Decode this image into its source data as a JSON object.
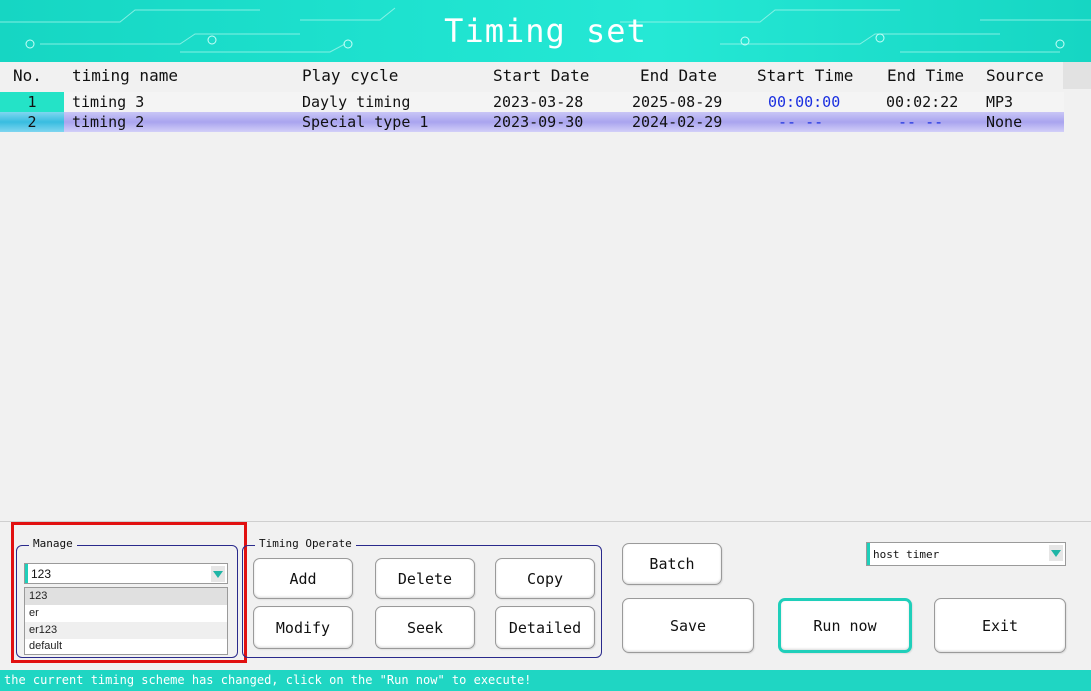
{
  "window": {
    "title": "Timing set"
  },
  "table": {
    "headers": [
      "No.",
      "timing name",
      "Play cycle",
      "Start Date",
      "End Date",
      "Start Time",
      "End Time",
      "Source"
    ],
    "rows": [
      {
        "no": "1",
        "name": "timing 3",
        "cycle": "Dayly timing",
        "start_date": "2023-03-28",
        "end_date": "2025-08-29",
        "start_time": "00:00:00",
        "end_time": "00:02:22",
        "source": "MP3"
      },
      {
        "no": "2",
        "name": "timing 2",
        "cycle": "Special type 1",
        "start_date": "2023-09-30",
        "end_date": "2024-02-29",
        "start_time": "-- --",
        "end_time": "-- --",
        "source": "None"
      }
    ]
  },
  "manage": {
    "legend": "Manage",
    "selected": "123",
    "options": [
      "123",
      "er",
      "er123",
      "default"
    ]
  },
  "timing_operate": {
    "legend": "Timing Operate",
    "add": "Add",
    "delete": "Delete",
    "copy": "Copy",
    "modify": "Modify",
    "seek": "Seek",
    "detailed": "Detailed"
  },
  "actions": {
    "batch": "Batch",
    "save": "Save",
    "run_now": "Run now",
    "exit": "Exit"
  },
  "timer_select": {
    "selected": "host timer"
  },
  "status_bar": {
    "text": "the current timing scheme has changed, click on the \"Run now\" to execute!"
  },
  "colors": {
    "accent": "#1fd6c3",
    "selected_row": "#a9a4ef",
    "time_blue": "#1a2fe0",
    "highlight_border": "#e11010"
  }
}
